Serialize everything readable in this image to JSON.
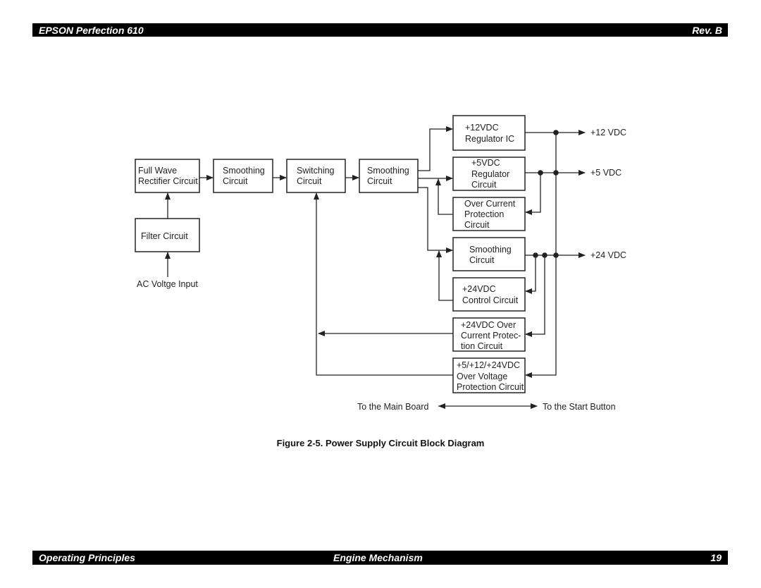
{
  "header": {
    "left": "EPSON Perfection 610",
    "right": "Rev. B"
  },
  "footer": {
    "left": "Operating Principles",
    "center": "Engine Mechanism",
    "page_number": "19"
  },
  "figure": {
    "caption": "Figure 2-5.  Power Supply Circuit Block Diagram",
    "blocks": {
      "rectifier": [
        "Full Wave",
        "Rectifier Circuit"
      ],
      "smoothing1": [
        "Smoothing",
        "Circuit"
      ],
      "switching": [
        "Switching",
        "Circuit"
      ],
      "smoothing2": [
        "Smoothing",
        "Circuit"
      ],
      "filter": [
        "Filter Circuit"
      ],
      "reg12": [
        "+12VDC",
        "Regulator IC"
      ],
      "reg5": [
        "+5VDC",
        "Regulator",
        "Circuit"
      ],
      "overcurrent": [
        "Over Current",
        "Protection",
        "Circuit"
      ],
      "smoothing3": [
        "Smoothing",
        "Circuit"
      ],
      "control24": [
        "+24VDC",
        "Control Circuit"
      ],
      "overcurrent24": [
        "+24VDC Over",
        "Current Protec-",
        "tion Circuit"
      ],
      "overvoltage": [
        "+5/+12/+24VDC",
        "Over Voltage",
        "Protection Circuit"
      ]
    },
    "labels": {
      "ac_input": "AC Voltge Input",
      "out12": "+12 VDC",
      "out5": "+5 VDC",
      "out24": "+24 VDC",
      "main_board": "To the Main Board",
      "start_button": "To the Start Button"
    }
  }
}
